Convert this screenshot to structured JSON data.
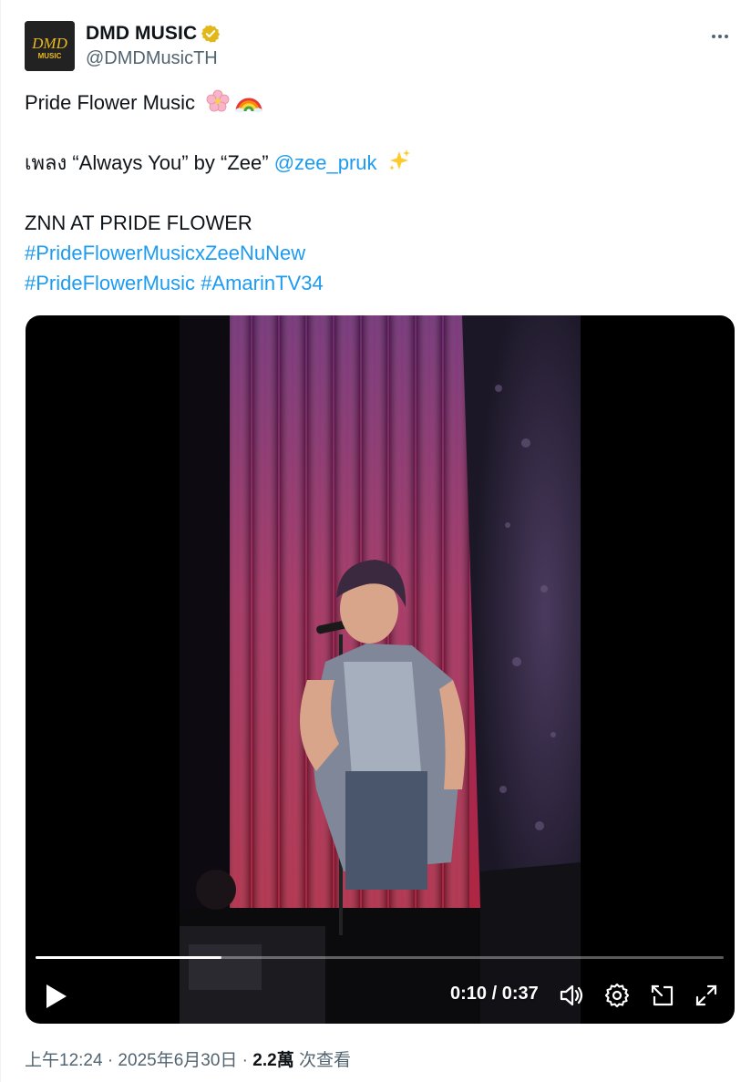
{
  "author": {
    "display_name": "DMD MUSIC",
    "handle": "@DMDMusicTH",
    "avatar_logo": "DMD",
    "avatar_sub": "MUSIC",
    "verified_color": "#e2b719"
  },
  "tweet": {
    "line1": "Pride Flower Music",
    "line2_prefix": "เพลง “Always You” by “Zee”",
    "mention": "@zee_pruk",
    "line3": "ZNN AT PRIDE FLOWER",
    "hashtag1": "#PrideFlowerMusicxZeeNuNew",
    "hashtag2": "#PrideFlowerMusic",
    "hashtag3": "#AmarinTV34",
    "emojis": [
      "cherry-blossom",
      "rainbow",
      "sparkles"
    ]
  },
  "video": {
    "current_time": "0:10",
    "duration": "0:37",
    "time_display": "0:10 / 0:37",
    "progress_fraction": 0.27
  },
  "footer": {
    "time_date": "上午12:24 · 2025年6月30日 · ",
    "views_count": "2.2萬",
    "views_label": " 次查看"
  },
  "colors": {
    "link": "#1d9bf0",
    "secondary_text": "#536471"
  }
}
